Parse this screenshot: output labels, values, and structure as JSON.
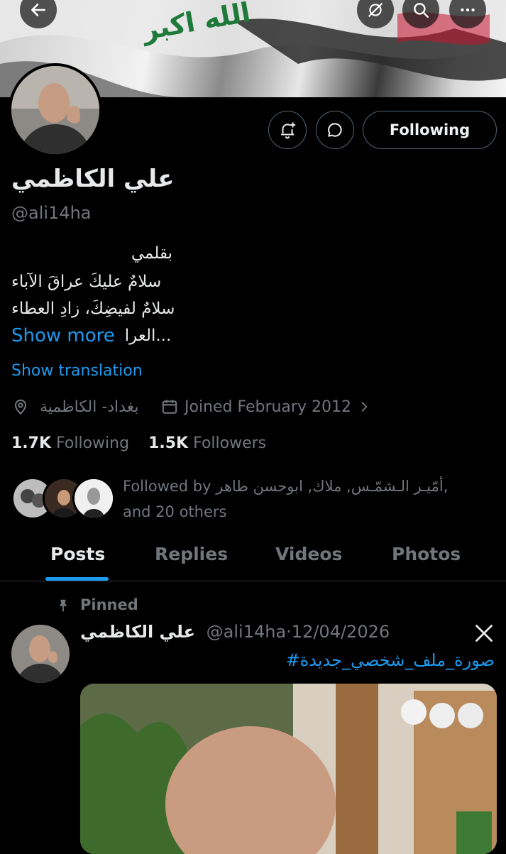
{
  "banner": {
    "text": "الله اكبر"
  },
  "header_icons": {
    "back": "arrow-left-icon",
    "link": "link-slash-icon",
    "search": "search-icon",
    "more": "more-dots-icon"
  },
  "actions": {
    "notify_icon": "bell-plus-icon",
    "message_icon": "message-icon",
    "following_label": "Following"
  },
  "profile": {
    "name": "علي الكاظمي",
    "handle": "@ali14ha",
    "bio_lines": [
      "بقلمي",
      "سلامٌ عليكَ عراقَ الآباء",
      "سلامٌ لفيضِكَ، زادِ العطاء"
    ],
    "bio_tail": "العرا...",
    "show_more": "Show more",
    "show_translation": "Show translation",
    "location": "بغداد- الكاظمية",
    "joined": "Joined February 2012",
    "following_count": "1.7K",
    "following_label": "Following",
    "followers_count": "1.5K",
    "followers_label": "Followers",
    "followed_by_line1": "Followed by أمّيـر الـشمّـس, ملاك, ابوحسن طاهر,",
    "followed_by_line2": "and 20 others"
  },
  "tabs": [
    {
      "label": "Posts",
      "active": true
    },
    {
      "label": "Replies",
      "active": false
    },
    {
      "label": "Videos",
      "active": false
    },
    {
      "label": "Photos",
      "active": false
    }
  ],
  "post": {
    "pinned_label": "Pinned",
    "author_name": "علي الكاظمي",
    "author_handle": "@ali14ha",
    "separator": "·",
    "date": "12/04/2026",
    "hashtag": "#صورة_ملف_شخصي_جديدة",
    "grok_icon": "x-grok-icon"
  },
  "colors": {
    "background": "#000000",
    "accent": "#1d9bf0",
    "text": "#e7e9ea",
    "muted": "#71767b",
    "border": "#536471"
  }
}
